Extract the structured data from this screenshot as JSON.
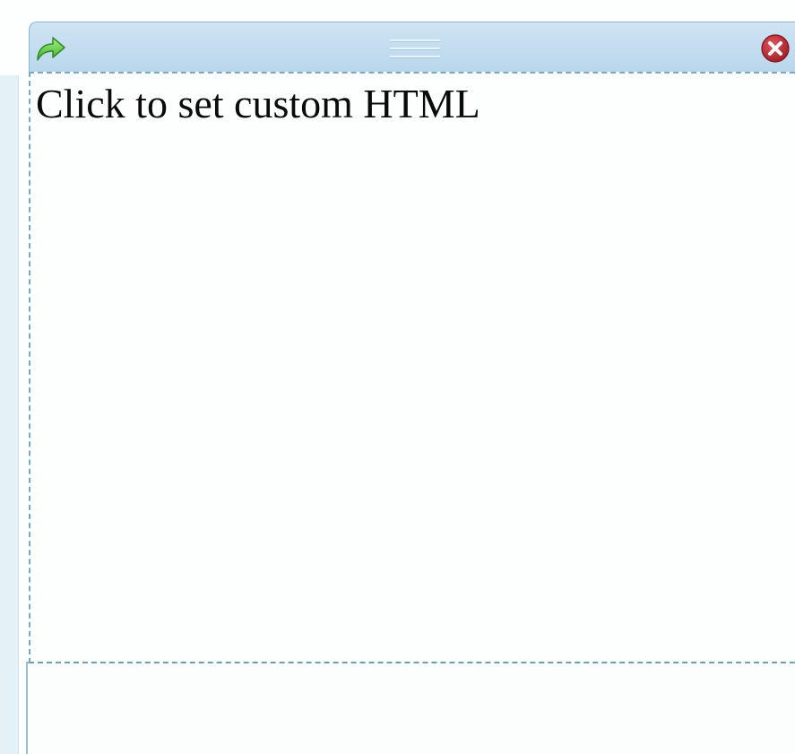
{
  "widget": {
    "content_text": "Click to set custom HTML"
  },
  "icons": {
    "restore": "green-arrow-icon",
    "drag": "drag-handle-icon",
    "close": "red-close-icon"
  },
  "colors": {
    "titlebar": "#c4ddef",
    "border": "#7aa9c2",
    "close": "#b0202a",
    "arrow": "#5bc93f"
  }
}
